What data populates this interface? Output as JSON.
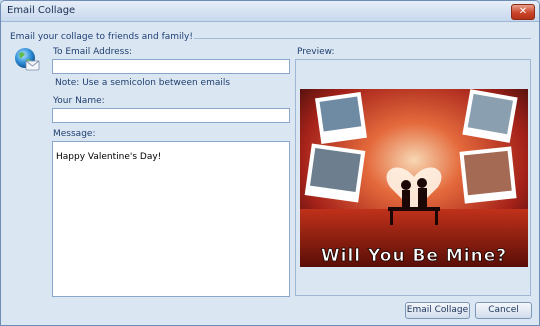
{
  "window": {
    "title": "Email Collage",
    "close_glyph": "✕"
  },
  "header": {
    "text": "Email your collage to friends and family!"
  },
  "form": {
    "to_label": "To Email Address:",
    "to_value": "",
    "note": "Note: Use a semicolon between emails",
    "name_label": "Your Name:",
    "name_value": "",
    "message_label": "Message:",
    "message_value": "Happy Valentine's Day!"
  },
  "preview": {
    "label": "Preview:",
    "collage_text": "Will You Be Mine?"
  },
  "buttons": {
    "email": "Email Collage",
    "cancel": "Cancel"
  },
  "colors": {
    "collage_dark": "#3a0c08",
    "collage_red": "#c0311a",
    "collage_glow": "#f7d7b3"
  },
  "icons": {
    "globe": "globe-email-icon",
    "close": "close-icon"
  }
}
